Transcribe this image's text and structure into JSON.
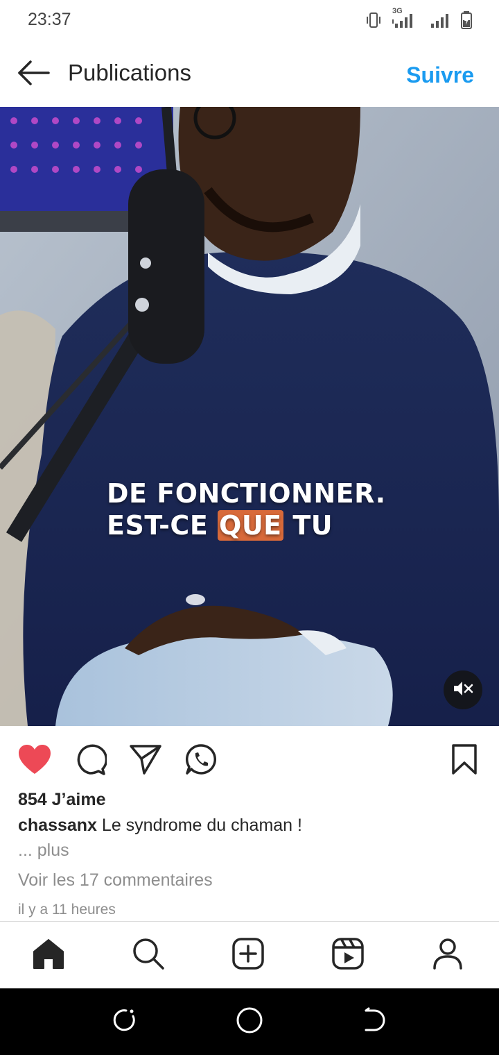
{
  "status_bar": {
    "time": "23:37",
    "network": "3G",
    "icons": [
      "vibrate-icon",
      "signal-icon",
      "signal-icon",
      "battery-icon"
    ]
  },
  "header": {
    "title": "Publications",
    "follow_label": "Suivre",
    "back_icon": "arrow-left-icon"
  },
  "media": {
    "caption_line1": "DE FONCTIONNER.",
    "caption_line2_a": "EST-CE ",
    "caption_line2_highlight": "QUE",
    "caption_line2_b": " TU",
    "mute_icon": "speaker-muted-icon",
    "highlight_color": "#d86a3a"
  },
  "actions": {
    "like_icon": "heart-filled-icon",
    "comment_icon": "comment-icon",
    "share_icon": "send-icon",
    "whatsapp_icon": "whatsapp-icon",
    "save_icon": "bookmark-icon",
    "like_color": "#ed4956"
  },
  "post": {
    "likes": "854 J’aime",
    "username": "chassanx",
    "caption": " Le syndrome du chaman !",
    "more": "... plus",
    "comments": "Voir les 17 commentaires",
    "time_ago": "il y a 11 heures"
  },
  "bottom_nav": {
    "items": [
      "home-icon",
      "search-icon",
      "create-icon",
      "reels-icon",
      "profile-icon"
    ]
  },
  "system_nav": {
    "items": [
      "recents-icon",
      "home-circle-icon",
      "back-icon"
    ]
  },
  "colors": {
    "accent": "#1a9bf0",
    "text": "#262626",
    "muted": "#8e8e8e"
  }
}
